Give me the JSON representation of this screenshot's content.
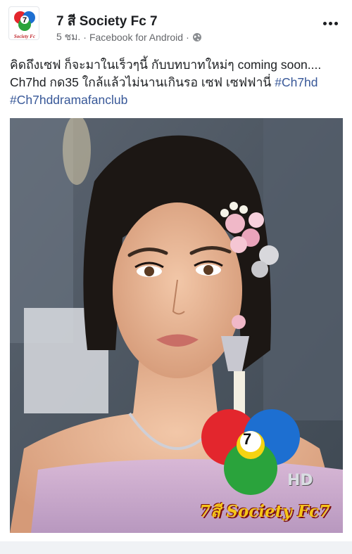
{
  "post": {
    "author": "7 สี Society Fc 7",
    "time": "5 ชม.",
    "separator": "·",
    "source": "Facebook for Android",
    "privacy_icon": "globe-icon",
    "more_icon": "more-options-icon",
    "text_main": "คิดถึงเซฟ ก็จะมาในเร็วๆนี้ กับบทบาทใหม่ๆ coming soon.... Ch7hd กด35 ใกล้แล้วไม่นานเกินรอ เซฟ เซฟฟานี่ ",
    "hashtags": [
      "#Ch7hd",
      "#Ch7hddramafanclub"
    ]
  },
  "photo": {
    "logo_number": "7",
    "hd_label": "HD",
    "watermark": "7สี Society Fc7"
  },
  "colors": {
    "hashtag": "#385898",
    "meta": "#65676b",
    "logo_red": "#e3262d",
    "logo_blue": "#1d6fd1",
    "logo_green": "#2aa33c",
    "logo_yellow": "#f5d312"
  }
}
